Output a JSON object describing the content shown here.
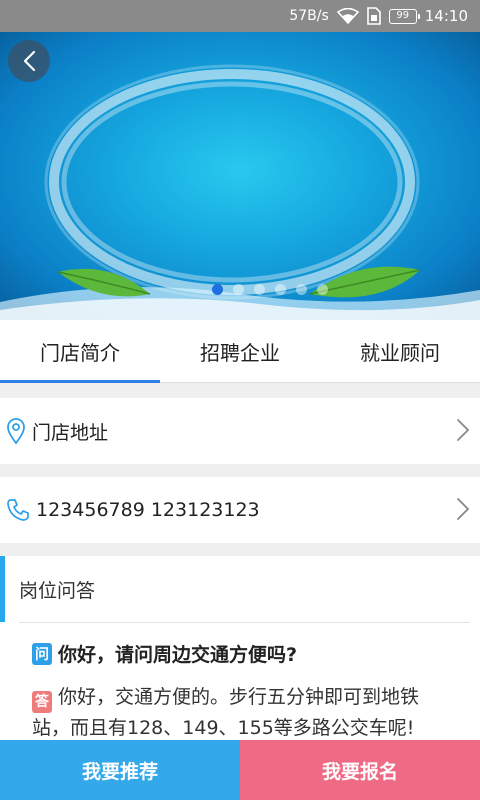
{
  "status_bar": {
    "speed": "57B/s",
    "battery": "99",
    "time": "14:10"
  },
  "banner": {
    "slide_count": 6,
    "active_slide": 1
  },
  "tabs": [
    {
      "label": "门店简介",
      "active": true
    },
    {
      "label": "招聘企业",
      "active": false
    },
    {
      "label": "就业顾问",
      "active": false
    }
  ],
  "address_row": {
    "label": "门店地址"
  },
  "phone_row": {
    "label": "123456789 123123123"
  },
  "qa": {
    "title": "岗位问答",
    "question_badge": "问",
    "question": "你好，请问周边交通方便吗?",
    "answer_badge": "答",
    "answer": "你好，交通方便的。步行五分钟即可到地铁站，而且有128、149、155等多路公交车呢!"
  },
  "buttons": {
    "recommend": "我要推荐",
    "signup": "我要报名"
  },
  "colors": {
    "accent": "#2f80e6",
    "recommend": "#33a8ea",
    "signup": "#ef6a85"
  }
}
